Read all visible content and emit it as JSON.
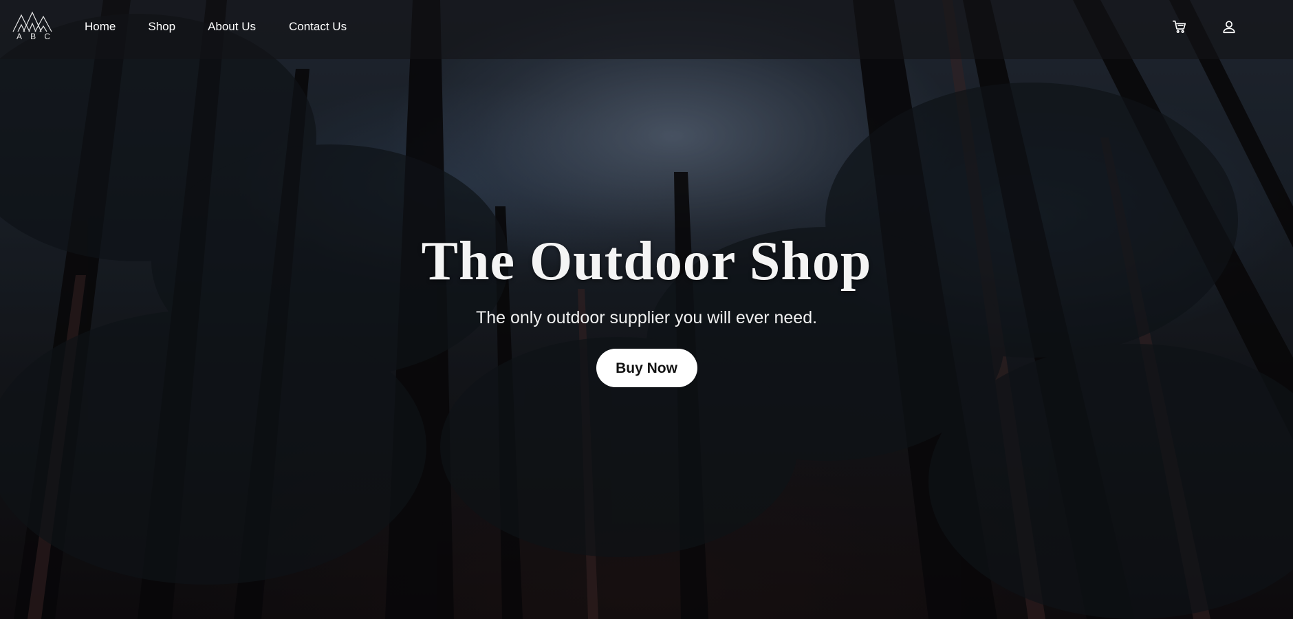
{
  "header": {
    "logo": {
      "letters": [
        "A",
        "B",
        "C"
      ],
      "icon": "mountains-logo"
    },
    "nav": [
      {
        "label": "Home"
      },
      {
        "label": "Shop"
      },
      {
        "label": "About Us"
      },
      {
        "label": "Contact Us"
      }
    ],
    "icons": [
      {
        "name": "cart-icon"
      },
      {
        "name": "user-icon"
      }
    ]
  },
  "hero": {
    "title": "The Outdoor Shop",
    "subtitle": "The only outdoor supplier you will ever need.",
    "cta_label": "Buy Now",
    "background": "forest-canopy-photo"
  },
  "colors": {
    "header_bg": "#141416",
    "text": "#ffffff",
    "button_bg": "#ffffff",
    "button_text": "#111111"
  }
}
